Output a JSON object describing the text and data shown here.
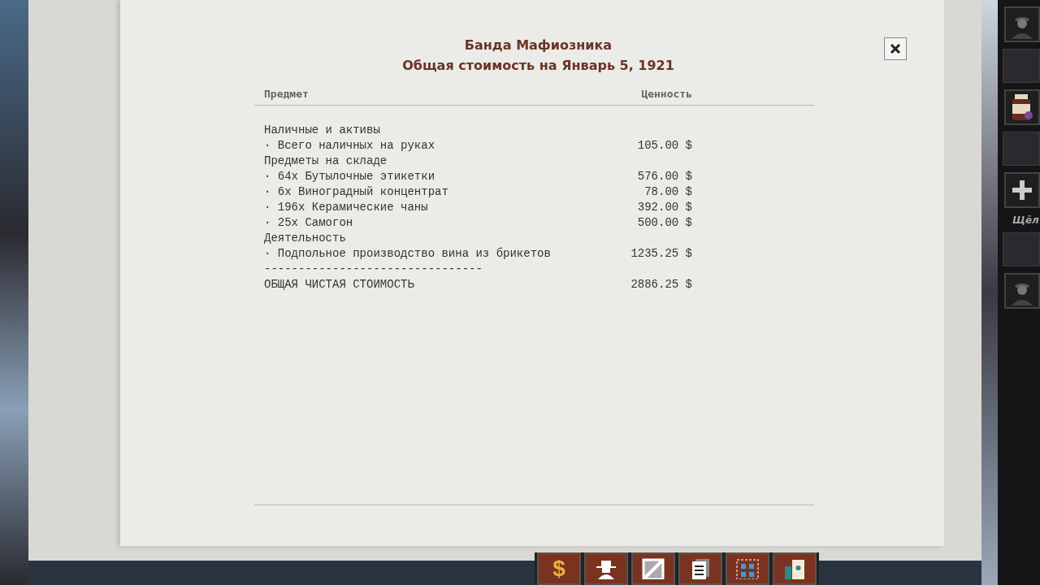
{
  "report": {
    "title": "Банда Мафиозника",
    "subtitle": "Общая стоимость на Январь 5, 1921",
    "columns": [
      "Предмет",
      "Ценность"
    ],
    "rows": [
      {
        "kind": "section",
        "label": "Наличные и активы"
      },
      {
        "kind": "item",
        "label": "· Всего наличных на руках",
        "value": "105.00 $"
      },
      {
        "kind": "section",
        "label": "Предметы на складе"
      },
      {
        "kind": "item",
        "label": "· 64x Бутылочные этикетки",
        "value": "576.00 $"
      },
      {
        "kind": "item",
        "label": "· 6x Виноградный концентрат",
        "value": "78.00 $"
      },
      {
        "kind": "item",
        "label": "· 196x Керамические чаны",
        "value": "392.00 $"
      },
      {
        "kind": "item",
        "label": "· 25x Самогон",
        "value": "500.00 $"
      },
      {
        "kind": "section",
        "label": "Деятельность"
      },
      {
        "kind": "item",
        "label": "· Подпольное производство вина из брикетов",
        "value": "1235.25 $"
      },
      {
        "kind": "separator",
        "label": "--------------------------------"
      },
      {
        "kind": "total",
        "label": "ОБЩАЯ ЧИСТАЯ СТОИМОСТЬ",
        "value": "2886.25 $"
      }
    ]
  },
  "sidebar": [
    {
      "kind": "portrait"
    },
    {
      "kind": "empty"
    },
    {
      "kind": "jar"
    },
    {
      "kind": "empty"
    },
    {
      "kind": "plus"
    },
    {
      "kind": "text",
      "label": "Щёл"
    },
    {
      "kind": "empty"
    },
    {
      "kind": "portrait"
    }
  ],
  "toolbar": [
    {
      "kind": "dollar",
      "label": "$"
    },
    {
      "kind": "agent"
    },
    {
      "kind": "slash"
    },
    {
      "kind": "document"
    },
    {
      "kind": "grid"
    },
    {
      "kind": "card"
    }
  ]
}
